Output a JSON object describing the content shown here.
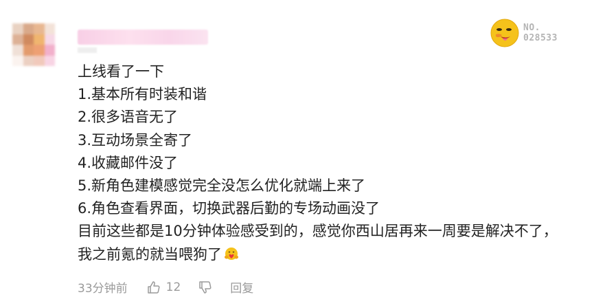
{
  "comment": {
    "lines": [
      "上线看了一下",
      "1.基本所有时装和谐",
      "2.很多语音无了",
      "3.互动场景全寄了",
      "4.收藏邮件没了",
      "5.新角色建模感觉完全没怎么优化就端上来了",
      "6.角色查看界面，切换武器后勤的专场动画没了",
      "目前这些都是10分钟体验感受到的，感觉你西山居再来一周要是解决不了，",
      "我之前氪的就当喂狗了"
    ],
    "emoji": "hug-emoji"
  },
  "badge": {
    "line1": "NO.",
    "line2": "028533"
  },
  "footer": {
    "time": "33分钟前",
    "like_count": "12",
    "reply_label": "回复"
  },
  "colors": {
    "text": "#222222",
    "meta": "#9a9a9a",
    "badge_face": "#f5c21b",
    "badge_text": "#b4b4b4"
  }
}
